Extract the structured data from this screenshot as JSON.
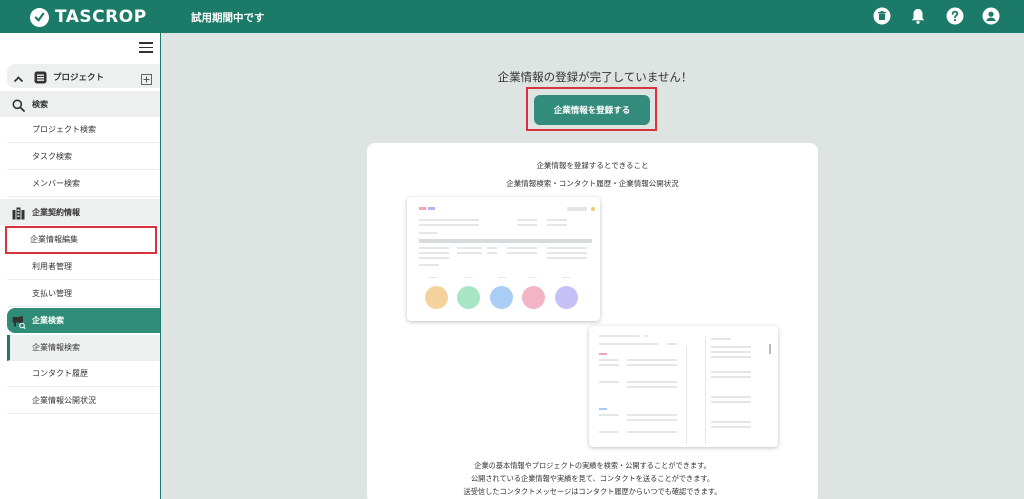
{
  "header": {
    "logo_text": "TASCROP",
    "trial_text": "試用期間中です",
    "icons": [
      "trash-icon",
      "bell-icon",
      "help-icon",
      "user-icon"
    ]
  },
  "sidebar": {
    "project_section": {
      "label": "プロジェクト",
      "icon": "project-list-icon"
    },
    "search_section": {
      "label": "検索",
      "icon": "search-icon"
    },
    "search_items": [
      "プロジェクト検索",
      "タスク検索",
      "メンバー検索"
    ],
    "contract_section": {
      "label": "企業契約情報",
      "icon": "building-icon"
    },
    "contract_items": [
      "企業情報編集",
      "利用者管理",
      "支払い管理"
    ],
    "company_search_section": {
      "label": "企業検索",
      "icon": "megaphone-icon"
    },
    "company_search_items": [
      "企業情報検索",
      "コンタクト履歴",
      "企業情報公開状況"
    ]
  },
  "main": {
    "title": "企業情報の登録が完了していません！",
    "register_button": "企業情報を登録する",
    "card": {
      "line1": "企業情報を登録するとできること",
      "line2": "企業情報検索・コンタクト履歴・企業情報公開状況",
      "desc": [
        "企業の基本情報やプロジェクトの実績を検索・公開することができます。",
        "公開されている企業情報や実績を見て、コンタクトを送ることができます。",
        "送受信したコンタクトメッセージはコンタクト履歴からいつでも確認できます。"
      ]
    }
  },
  "colors": {
    "brand": "#1b7a68",
    "button": "#338b7b",
    "highlight": "#d8323c",
    "preview_circles": [
      "#f3d39b",
      "#a7e6c4",
      "#a9cdf5",
      "#f3b4c8",
      "#c5c0f5"
    ]
  }
}
